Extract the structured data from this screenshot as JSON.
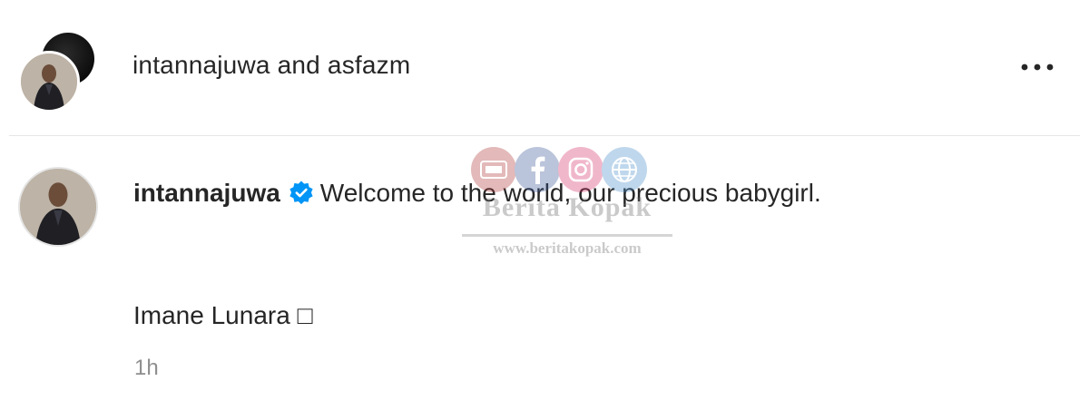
{
  "header": {
    "title": "intannajuwa and asfazm",
    "more_icon": "more-horizontal-icon"
  },
  "caption": {
    "username": "intannajuwa",
    "verified_icon": "verified-badge-icon",
    "text": "Welcome to the world, our precious babygirl.",
    "line2": "Imane Lunara □",
    "timestamp": "1h"
  },
  "watermark": {
    "title": "Berita Kopak",
    "url": "www.beritakopak.com"
  },
  "colors": {
    "text": "#262626",
    "muted": "#8e8e8e",
    "verified": "#0095f6",
    "divider": "#e6e6e6"
  }
}
